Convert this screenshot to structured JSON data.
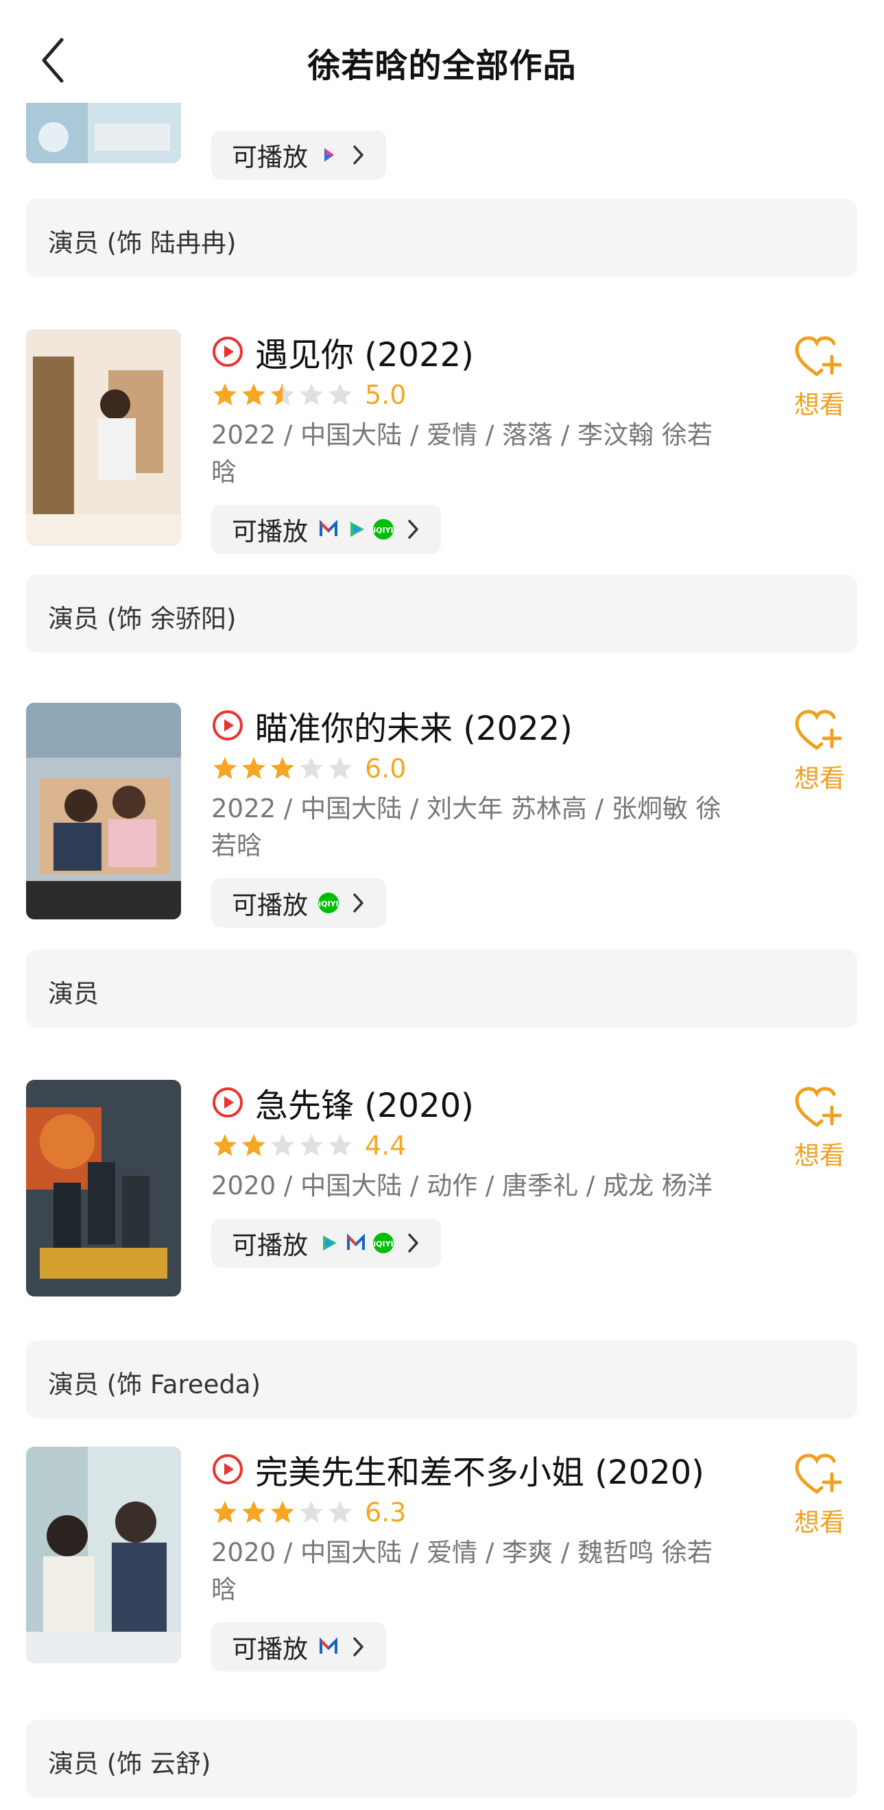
{
  "header": {
    "title": "徐若晗的全部作品",
    "back_icon": "chevron-left-icon"
  },
  "top_partial": {
    "play_label": "可播放",
    "platforms": [
      "youku-icon"
    ],
    "role": "演员 (饰 陆冉冉)"
  },
  "works": [
    {
      "title": "遇见你 (2022)",
      "stars": 2.5,
      "score": "5.0",
      "meta": "2022 / 中国大陆 / 爱情 / 落落 / 李汶翰 徐若晗",
      "play_label": "可播放",
      "platforms": [
        "mgtv-icon",
        "tencent-video-icon",
        "iqiyi-icon"
      ],
      "want_label": "想看",
      "role": "演员 (饰 余骄阳)"
    },
    {
      "title": "瞄准你的未来 (2022)",
      "stars": 3,
      "score": "6.0",
      "meta": "2022 / 中国大陆 / 刘大年 苏林高 / 张炯敏 徐若晗",
      "play_label": "可播放",
      "platforms": [
        "iqiyi-icon"
      ],
      "want_label": "想看",
      "role": "演员"
    },
    {
      "title": "急先锋 (2020)",
      "stars": 2,
      "score": "4.4",
      "meta": "2020 / 中国大陆 / 动作 / 唐季礼 / 成龙 杨洋",
      "play_label": "可播放",
      "platforms": [
        "tencent-video-icon",
        "mgtv-icon",
        "iqiyi-icon"
      ],
      "want_label": "想看",
      "role": "演员 (饰 Fareeda)"
    },
    {
      "title": "完美先生和差不多小姐 (2020)",
      "stars": 3,
      "score": "6.3",
      "meta": "2020 / 中国大陆 / 爱情 / 李爽 / 魏哲鸣 徐若晗",
      "play_label": "可播放",
      "platforms": [
        "mgtv-icon"
      ],
      "want_label": "想看",
      "role": "演员 (饰 云舒)"
    }
  ],
  "colors": {
    "accent": "#f0a020",
    "play_red": "#e8332e",
    "iqiyi_green": "#00be06"
  }
}
